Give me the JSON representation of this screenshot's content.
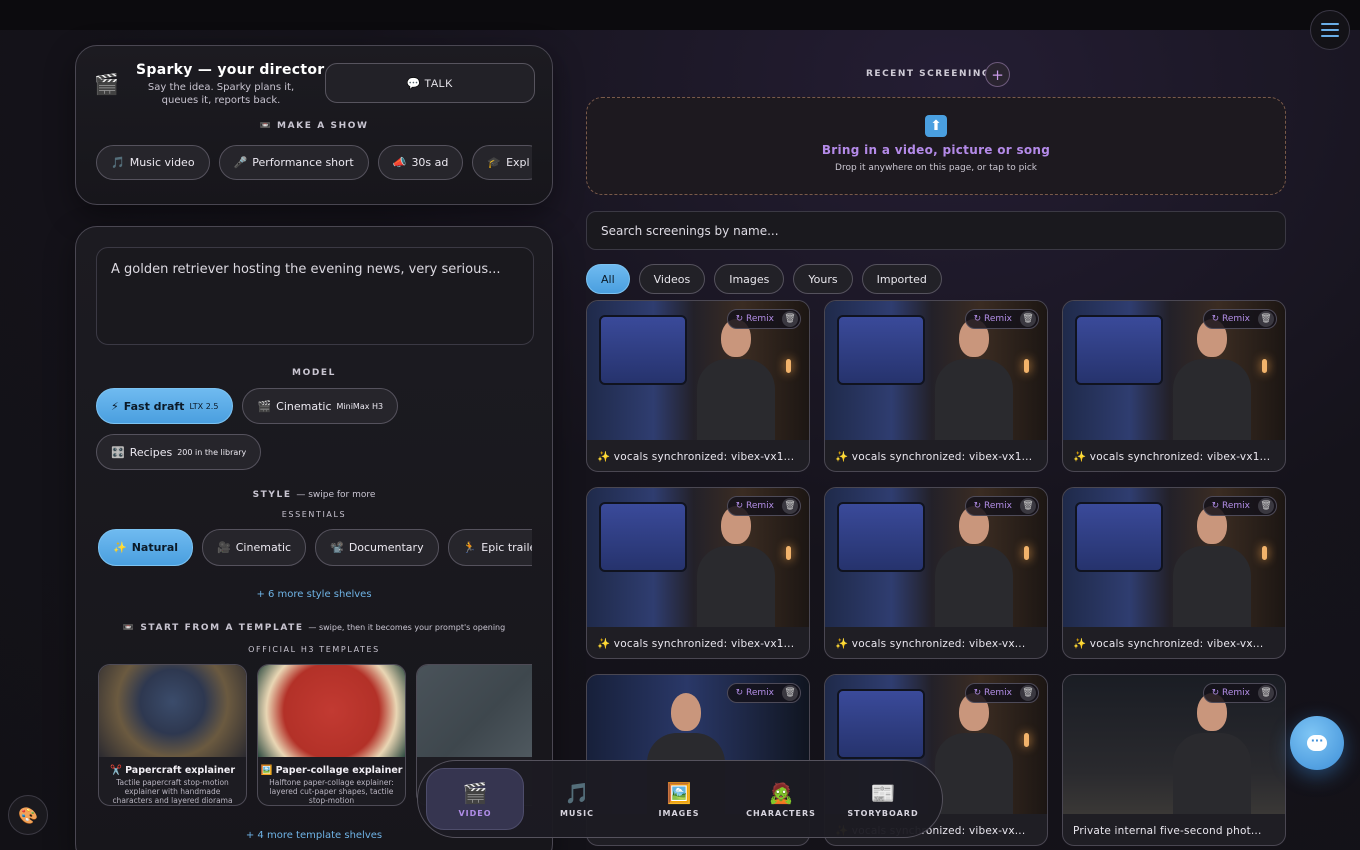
{
  "director": {
    "title": "Sparky — your director",
    "subtitle": "Say the idea. Sparky plans it, queues it, reports back.",
    "talk_label": "💬 TALK",
    "make_show_caption": "📼 MAKE A SHOW",
    "show_types": [
      {
        "icon": "🎵",
        "label": "Music video"
      },
      {
        "icon": "🎤",
        "label": "Performance short"
      },
      {
        "icon": "📣",
        "label": "30s ad"
      },
      {
        "icon": "🎓",
        "label": "Expl"
      }
    ]
  },
  "composer": {
    "prompt_text": "A golden retriever hosting the evening news, very serious...",
    "model_caption": "MODEL",
    "models": [
      {
        "icon": "⚡",
        "label": "Fast draft",
        "tag": "LTX 2.5",
        "active": true
      },
      {
        "icon": "🎬",
        "label": "Cinematic",
        "tag": "MiniMax H3",
        "active": false
      }
    ],
    "recipes": {
      "icon": "🎛️",
      "label": "Recipes",
      "sup": "200 in the library"
    },
    "style_caption": "STYLE",
    "style_hint": "— swipe for more",
    "essentials_caption": "ESSENTIALS",
    "styles": [
      {
        "icon": "✨",
        "label": "Natural",
        "active": true
      },
      {
        "icon": "🎥",
        "label": "Cinematic",
        "active": false
      },
      {
        "icon": "📽️",
        "label": "Documentary",
        "active": false
      },
      {
        "icon": "🏃",
        "label": "Epic traile",
        "active": false
      }
    ],
    "more_styles": "+ 6 more style shelves",
    "template_caption": "📼 START FROM A TEMPLATE",
    "template_hint": "— swipe, then it becomes your prompt's opening",
    "official_caption": "OFFICIAL H3 TEMPLATES",
    "templates": [
      {
        "icon": "✂️",
        "title": "Papercraft explainer",
        "desc": "Tactile papercraft stop-motion explainer with handmade characters and layered diorama"
      },
      {
        "icon": "🖼️",
        "title": "Paper-collage explainer",
        "desc": "Halftone paper-collage explainer: layered cut-paper shapes, tactile stop-motion"
      },
      {
        "icon": "",
        "title": "",
        "desc": ""
      }
    ],
    "more_templates": "+ 4 more template shelves"
  },
  "screenings": {
    "caption": "RECENT SCREENINGS",
    "add_label": "+",
    "drop_icon": "⬆",
    "drop_title": "Bring in a video, picture or song",
    "drop_sub": "Drop it anywhere on this page, or tap to pick",
    "search_placeholder": "Search screenings by name...",
    "filters": [
      {
        "label": "All",
        "active": true
      },
      {
        "label": "Videos",
        "active": false
      },
      {
        "label": "Images",
        "active": false
      },
      {
        "label": "Yours",
        "active": false
      },
      {
        "label": "Imported",
        "active": false
      }
    ],
    "remix_label": "↻ Remix",
    "trash_icon": "🗑",
    "items": [
      {
        "caption": "✨ vocals synchronized: vibex-vx1...",
        "variant": "office"
      },
      {
        "caption": "✨ vocals synchronized: vibex-vx1...",
        "variant": "office"
      },
      {
        "caption": "✨ vocals synchronized: vibex-vx1...",
        "variant": "office"
      },
      {
        "caption": "✨ vocals synchronized: vibex-vx1...",
        "variant": "office"
      },
      {
        "caption": "✨ vocals synchronized: vibex-vx...",
        "variant": "office"
      },
      {
        "caption": "✨ vocals synchronized: vibex-vx...",
        "variant": "office"
      },
      {
        "caption": "",
        "variant": "stage"
      },
      {
        "caption": "✨ vocals synchronized: vibex-vx...",
        "variant": "office"
      },
      {
        "caption": "Private internal five-second phot...",
        "variant": "room"
      }
    ]
  },
  "dock": [
    {
      "icon": "🎬",
      "label": "VIDEO",
      "active": true
    },
    {
      "icon": "🎵",
      "label": "MUSIC",
      "active": false
    },
    {
      "icon": "🖼️",
      "label": "IMAGES",
      "active": false
    },
    {
      "icon": "🧟",
      "label": "CHARACTERS",
      "active": false
    },
    {
      "icon": "📰",
      "label": "STORYBOARD",
      "active": false
    }
  ],
  "icons": {
    "menu": "hamburger-menu-icon",
    "chat": "chat-bubble-icon",
    "palette": "palette-icon",
    "director": "clapperboard-icon",
    "chat_glyph": "···"
  },
  "colors": {
    "accent_blue": "#5aa9e6",
    "accent_purple": "#b48ae8",
    "background": "#15131b"
  }
}
